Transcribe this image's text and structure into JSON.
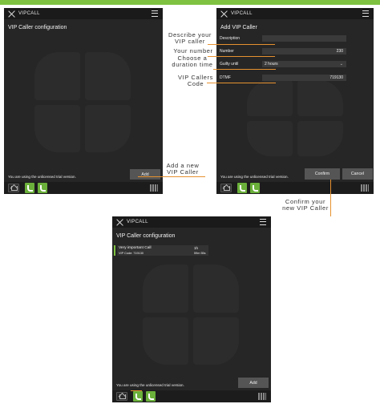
{
  "colors": {
    "brand_green": "#7fc242",
    "accent_orange": "#e6912f",
    "panel_bg": "#262626"
  },
  "screen1": {
    "app_name": "VIPCALL",
    "title": "VIP Caller configuration",
    "trial_text": "You are using the unlicensed trial version.",
    "add_button": "Add"
  },
  "screen2": {
    "app_name": "VIPCALL",
    "title": "Add VIP Caller",
    "fields": [
      {
        "label": "Description",
        "value": ""
      },
      {
        "label": "Number",
        "value": "230"
      },
      {
        "label": "Guilty until",
        "value": "2 hours"
      },
      {
        "label": "DTMF",
        "value": "719130"
      }
    ],
    "trial_text": "You are using the unlicensed trial version.",
    "confirm_button": "Confirm",
    "cancel_button": "Cancel"
  },
  "screen3": {
    "app_name": "VIPCALL",
    "title": "VIP Caller configuration",
    "item": {
      "name": "Very important Call",
      "code": "VIP Code: 719130",
      "count": "1h",
      "duration": "59m 55s"
    },
    "trial_text": "You are using the unlicensed trial version.",
    "add_button": "Add"
  },
  "callouts": {
    "describe": [
      "Describe your",
      "VIP caller"
    ],
    "number": [
      "Your number"
    ],
    "duration": [
      "Choose a",
      "duration time"
    ],
    "dtmf": [
      "VIP Callers",
      "Code"
    ],
    "add": [
      "Add a new",
      "VIP Caller"
    ],
    "confirm": [
      "Confirm your",
      "new VIP Caller"
    ]
  },
  "icons": [
    "close-icon",
    "menu-icon",
    "home-icon",
    "call-icon",
    "grid-icon",
    "chevron-down-icon"
  ]
}
